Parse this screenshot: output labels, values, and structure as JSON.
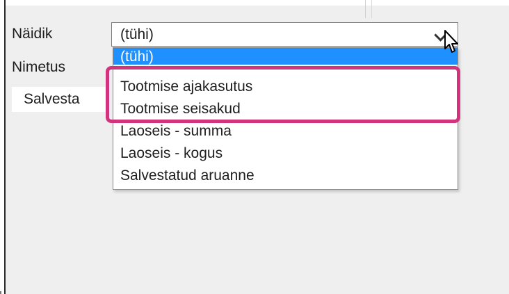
{
  "form": {
    "naidik_label": "Näidik",
    "nimetus_label": "Nimetus",
    "save_label": "Salvesta"
  },
  "select": {
    "selected_value": "(tühi)",
    "options": [
      "(tühi)",
      "Tootmise ajakasutus",
      "Tootmise seisakud",
      "Laoseis - summa",
      "Laoseis - kogus",
      "Salvestatud aruanne"
    ],
    "highlight_color": "#d1337d",
    "selected_option_color": "#1e90ff"
  },
  "icons": {
    "dropdown_arrow": "chevron-down-icon",
    "mouse_pointer": "mouse-pointer-icon"
  }
}
